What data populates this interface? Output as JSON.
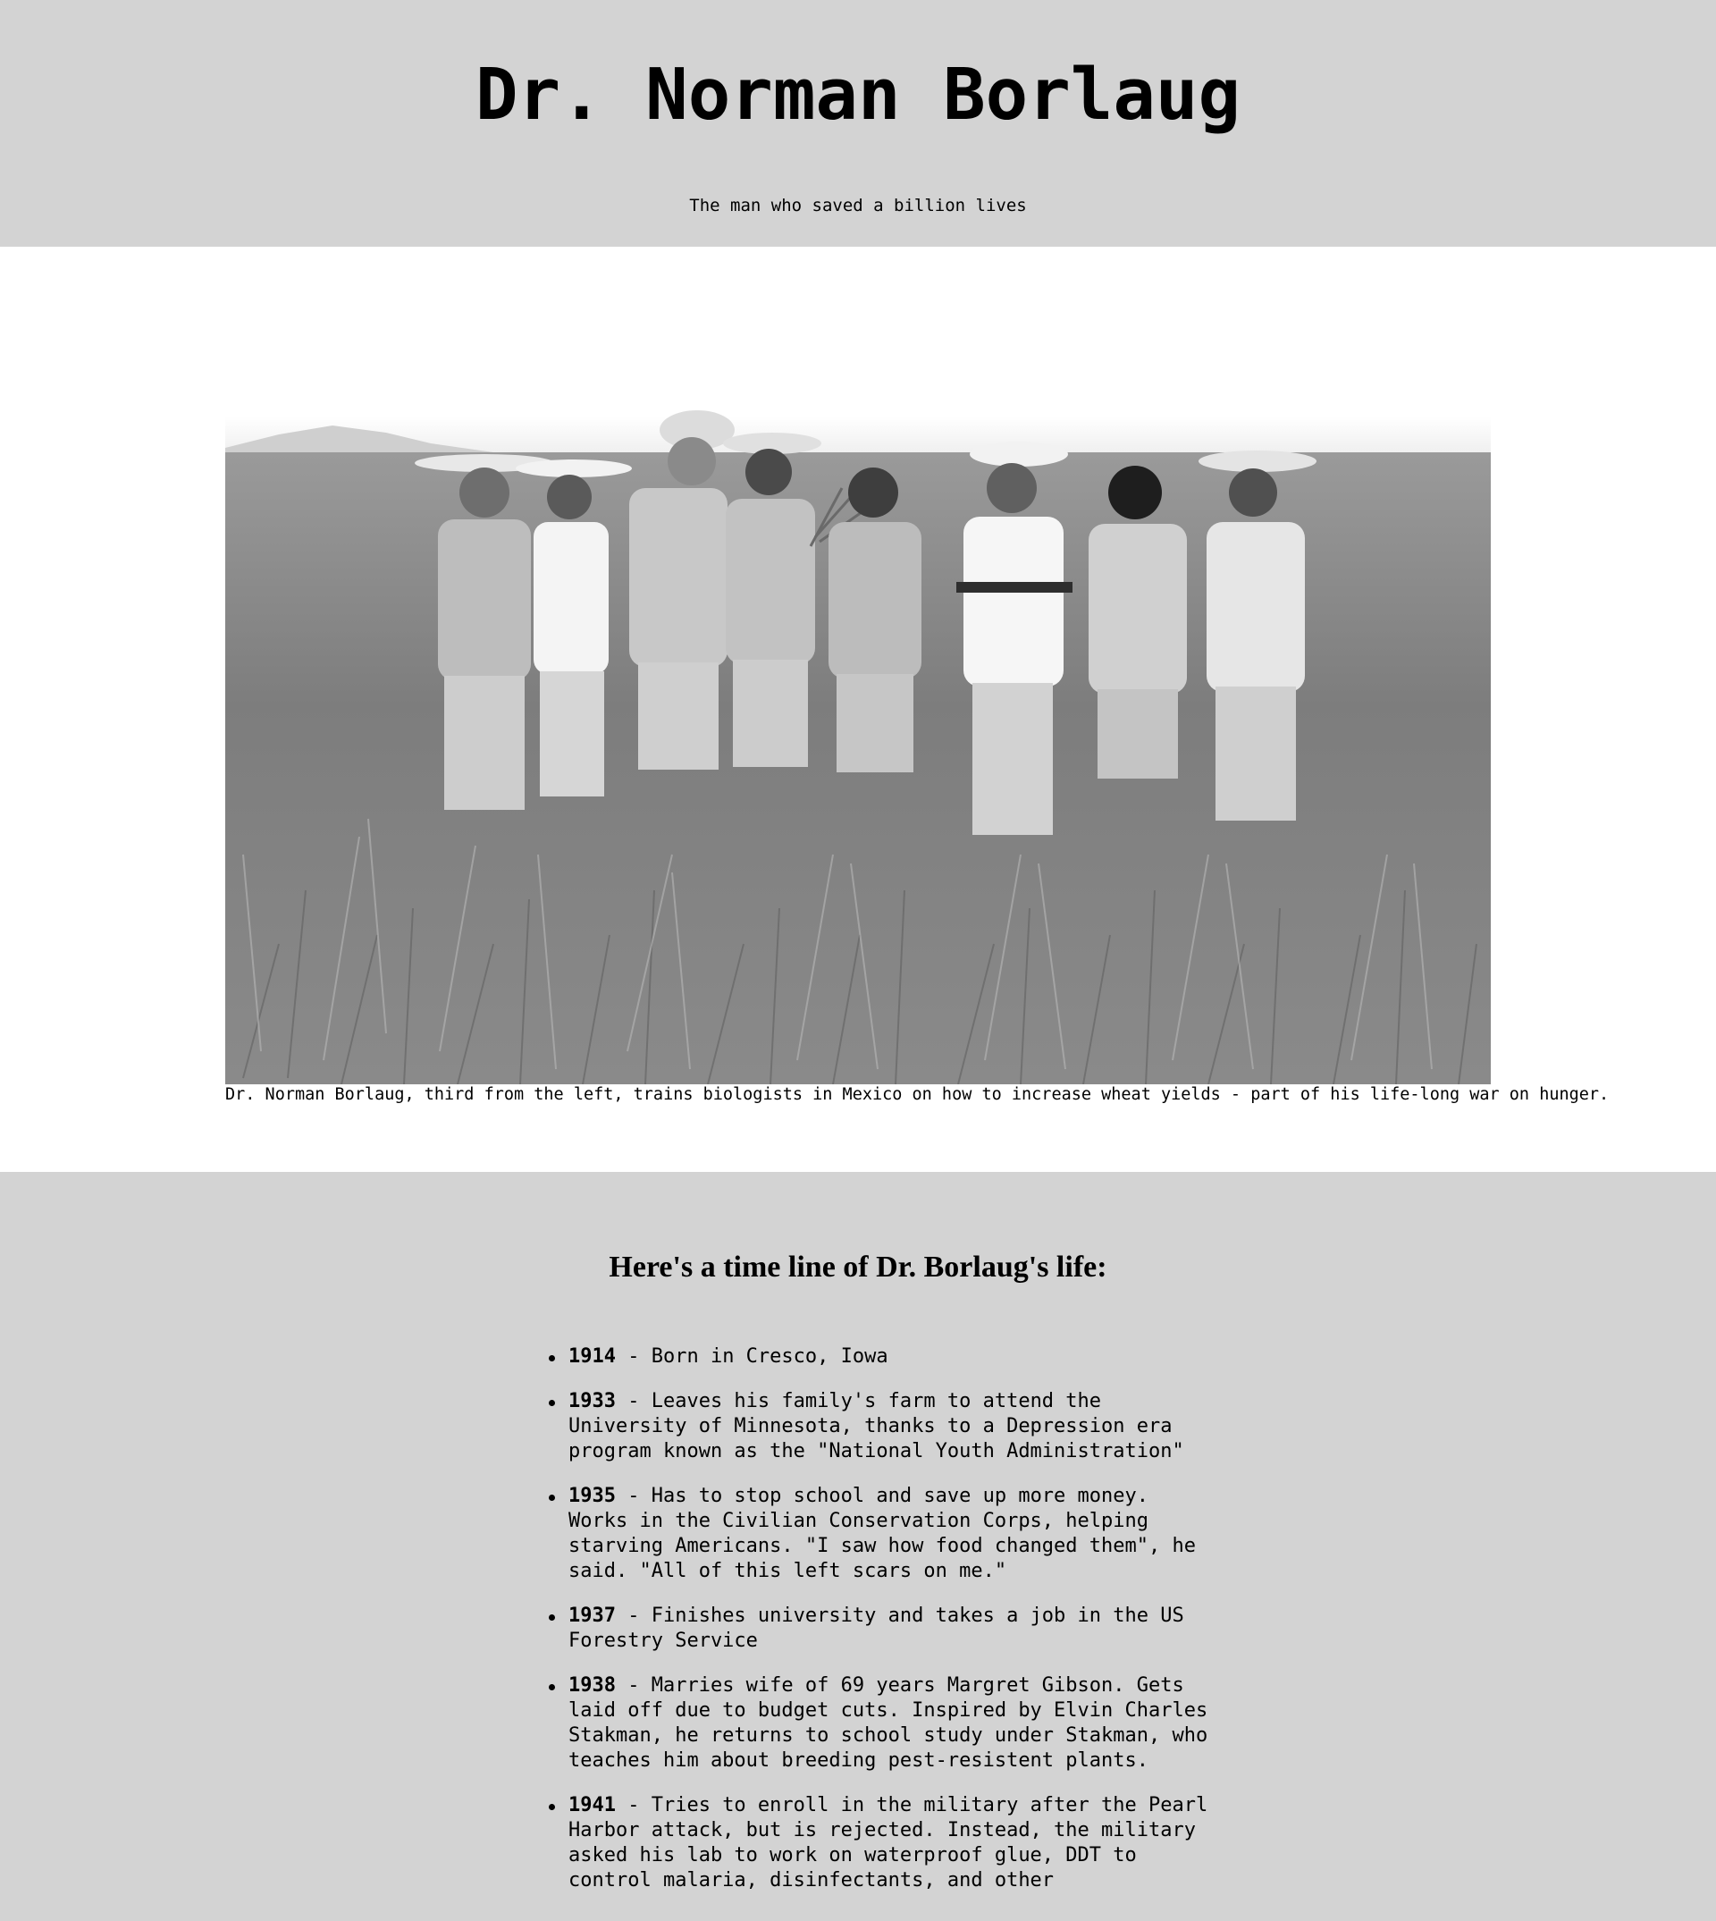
{
  "header": {
    "title": "Dr. Norman Borlaug",
    "subtitle": "The man who saved a billion lives"
  },
  "photo": {
    "caption": "Dr. Norman Borlaug, third from the left, trains biologists in Mexico on how to increase wheat yields - part of his life-long war on hunger."
  },
  "timeline": {
    "heading": "Here's a time line of Dr. Borlaug's life:",
    "items": [
      {
        "year": "1914",
        "text": " - Born in Cresco, Iowa"
      },
      {
        "year": "1933",
        "text": " - Leaves his family's farm to attend the University of Minnesota, thanks to a Depression era program known as the \"National Youth Administration\""
      },
      {
        "year": "1935",
        "text": " - Has to stop school and save up more money. Works in the Civilian Conservation Corps, helping starving Americans. \"I saw how food changed them\", he said. \"All of this left scars on me.\""
      },
      {
        "year": "1937",
        "text": " - Finishes university and takes a job in the US Forestry Service"
      },
      {
        "year": "1938",
        "text": " - Marries wife of 69 years Margret Gibson. Gets laid off due to budget cuts. Inspired by Elvin Charles Stakman, he returns to school study under Stakman, who teaches him about breeding pest-resistent plants."
      },
      {
        "year": "1941",
        "text": " - Tries to enroll in the military after the Pearl Harbor attack, but is rejected. Instead, the military asked his lab to work on waterproof glue, DDT to control malaria, disinfectants, and other"
      }
    ]
  }
}
